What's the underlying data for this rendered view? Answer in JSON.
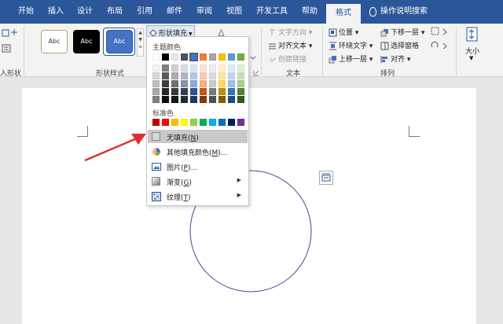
{
  "tabs": [
    "开始",
    "插入",
    "设计",
    "布局",
    "引用",
    "邮件",
    "审阅",
    "视图",
    "开发工具",
    "帮助",
    "格式"
  ],
  "tell_me": "操作说明搜索",
  "ribbon": {
    "insert_shapes_label": "入形状",
    "shape_styles_label": "形状样式",
    "style_swatch_text": "Abc",
    "shape_fill": "形状填充",
    "text_group_label": "文本",
    "text_direction": "文字方向",
    "align_text": "对齐文本",
    "create_link": "创建链接",
    "arrange_label": "排列",
    "position": "位置",
    "wrap_text": "环绕文字",
    "bring_forward": "上移一层",
    "send_backward": "下移一层",
    "selection_pane": "选择窗格",
    "align": "对齐",
    "size": "大小"
  },
  "dropdown": {
    "theme_colors_label": "主题颜色",
    "standard_colors_label": "标准色",
    "theme_row": [
      "#ffffff",
      "#000000",
      "#e7e6e6",
      "#44546a",
      "#4472c4",
      "#ed7d31",
      "#a5a5a5",
      "#ffc000",
      "#5b9bd5",
      "#70ad47"
    ],
    "theme_shades": [
      [
        "#f2f2f2",
        "#7f7f7f",
        "#d0cece",
        "#d6dce4",
        "#dae3f3",
        "#fbe5d6",
        "#ededed",
        "#fff2cc",
        "#deebf7",
        "#e2f0d9"
      ],
      [
        "#d9d9d9",
        "#595959",
        "#aeabab",
        "#adb9ca",
        "#b4c7e7",
        "#f8cbad",
        "#dbdbdb",
        "#ffe699",
        "#bdd7ee",
        "#c5e0b4"
      ],
      [
        "#bfbfbf",
        "#404040",
        "#757171",
        "#8497b0",
        "#8faadc",
        "#f4b183",
        "#c9c9c9",
        "#ffd966",
        "#9dc3e6",
        "#a9d18e"
      ],
      [
        "#a6a6a6",
        "#262626",
        "#3a3838",
        "#333f50",
        "#2f5597",
        "#c55a11",
        "#7b7b7b",
        "#bf9000",
        "#2e75b6",
        "#538135"
      ],
      [
        "#7f7f7f",
        "#0d0d0d",
        "#171616",
        "#222a35",
        "#203864",
        "#843c0c",
        "#525252",
        "#7f6000",
        "#1f4e79",
        "#375623"
      ]
    ],
    "standard_row": [
      "#c00000",
      "#ff0000",
      "#ffc000",
      "#ffff00",
      "#92d050",
      "#00b050",
      "#00b0f0",
      "#0070c0",
      "#002060",
      "#7030a0"
    ],
    "no_fill": "无填充(",
    "no_fill_key": "N",
    "more_colors": "其他填充颜色(",
    "more_colors_key": "M",
    "more_colors_tail": ")...",
    "picture": "图片(",
    "picture_key": "P",
    "picture_tail": ")...",
    "gradient": "渐变(",
    "gradient_key": "G",
    "texture": "纹理(",
    "texture_key": "T",
    "close_paren": ")"
  },
  "colors": {
    "accent": "#2b579a",
    "annotation_arrow": "#e03030",
    "circle_stroke": "#3b4a8c"
  }
}
